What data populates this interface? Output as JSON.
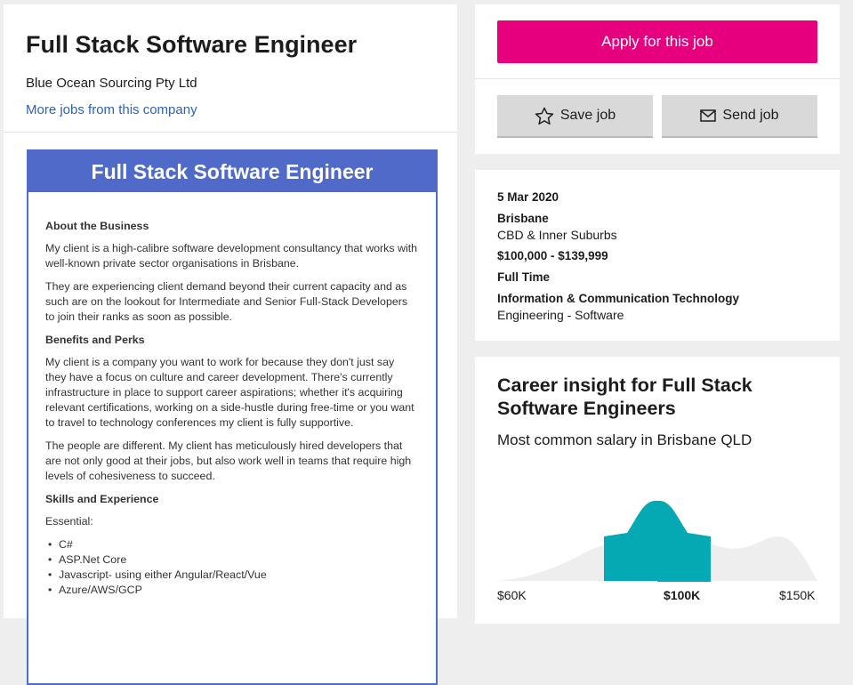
{
  "header": {
    "job_title": "Full Stack Software Engineer",
    "company": "Blue Ocean Sourcing Pty Ltd",
    "more_jobs": "More jobs from this company"
  },
  "ad": {
    "banner_title": "Full Stack Software Engineer",
    "sections": {
      "about_heading": "About the Business",
      "about_p1": "My client is a high-calibre software development consultancy that works with well-known private sector organisations in Brisbane.",
      "about_p2": "They are experiencing client demand beyond their current capacity and as such are on the lookout for Intermediate and Senior Full-Stack Developers to join their ranks as soon as possible.",
      "benefits_heading": "Benefits and Perks",
      "benefits_p1": "My client is a company you want to work for because they don't just say they have a focus on culture and career development. There's currently infrastructure in place to support career aspirations; whether it's acquiring relevant certifications, working on a side-hustle during free-time or you want to travel to technology conferences my client is fully supportive.",
      "benefits_p2": "The people are different. My client has meticulously hired developers that are not only good at their jobs, but also work well in teams that require high levels of cohesiveness to succeed.",
      "skills_heading": "Skills and Experience",
      "essential_label": "Essential:",
      "skills": [
        "C#",
        "ASP.Net Core",
        "Javascript- using either Angular/React/Vue",
        "Azure/AWS/GCP"
      ]
    }
  },
  "actions": {
    "apply_label": "Apply for this job",
    "save_label": "Save job",
    "send_label": "Send job"
  },
  "details": {
    "date": "5 Mar 2020",
    "location": "Brisbane",
    "area": "CBD & Inner Suburbs",
    "salary": "$100,000 - $139,999",
    "work_type": "Full Time",
    "classification": "Information & Communication Technology",
    "subclassification": "Engineering - Software"
  },
  "insight": {
    "title": "Career insight for Full Stack Software Engineers",
    "subtitle": "Most common salary in Brisbane QLD",
    "labels": {
      "low": "$60K",
      "mid": "$100K",
      "high": "$150K"
    }
  },
  "colors": {
    "brand_pink": "#e6007e",
    "ad_blue": "#4f6ac9",
    "link_blue": "#2e64b0",
    "highlight_teal": "#04a9b4",
    "distribution_grey": "#eeeeee"
  },
  "chart_data": {
    "type": "area",
    "title": "Most common salary in Brisbane QLD",
    "x_labels": [
      "$60K",
      "$100K",
      "$150K"
    ],
    "highlighted_bucket": "$100K",
    "xlim_k": [
      60,
      150
    ],
    "highlight_range_k": [
      90,
      110
    ]
  }
}
